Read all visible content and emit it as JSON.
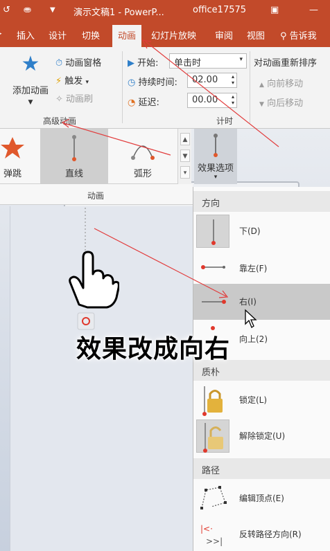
{
  "title_bar": {
    "menu_glyph": "▼",
    "doc_title": "演示文稿1 - PowerP...",
    "account": "office17575"
  },
  "tabs": [
    "插入",
    "设计",
    "切换",
    "动画",
    "幻灯片放映",
    "审阅",
    "视图",
    "告诉我"
  ],
  "active_tab": "动画",
  "ribbon": {
    "add_animation": "添加动画",
    "animation_pane": "动画窗格",
    "trigger": "触发",
    "animation_painter": "动画刷",
    "advanced_group": "高级动画",
    "start_label": "开始:",
    "start_value": "单击时",
    "duration_label": "持续时间:",
    "duration_value": "02.00",
    "delay_label": "延迟:",
    "delay_value": "00.00",
    "timing_group": "计时",
    "reorder_title": "对动画重新排序",
    "move_earlier": "向前移动",
    "move_later": "向后移动"
  },
  "gallery": {
    "items": [
      "弹跳",
      "直线",
      "弧形"
    ],
    "selected": "直线",
    "effect_options": "效果选项",
    "group_label": "动画"
  },
  "menu": {
    "direction_header": "方向",
    "direction_items": [
      "下(D)",
      "靠左(F)",
      "右(I)",
      "向上(2)"
    ],
    "highlighted": "右(I)",
    "lock_header": "质朴",
    "lock_items": [
      "锁定(L)",
      "解除锁定(U)"
    ],
    "path_header": "路径",
    "path_items": [
      "编辑顶点(E)",
      "反转路径方向(R)"
    ]
  },
  "caption": "效果改成向右",
  "colors": {
    "accent": "#c24a2a",
    "pointer_line": "#e23b3b"
  }
}
